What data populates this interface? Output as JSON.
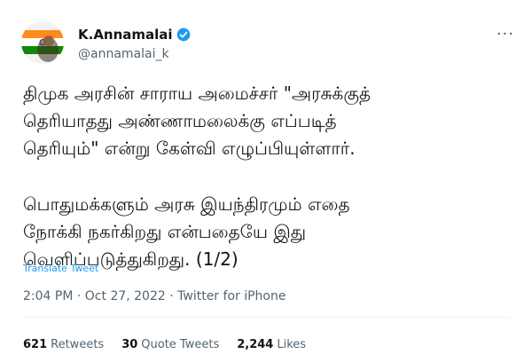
{
  "author": {
    "name": "K.Annamalai",
    "handle": "@annamalai_k",
    "verified": true
  },
  "tweet": {
    "lines": [
      "திமுக அரசின் சாராய அமைச்சர் \"அரசுக்குத்",
      "தெரியாதது அண்ணாமலைக்கு எப்படித்",
      "தெரியும்\" என்று கேள்வி எழுப்பியுள்ளார்.",
      "பொதுமக்களும் அரசு இயந்திரமும் எதை",
      "நோக்கி நகர்கிறது என்பதையே இது",
      "வெளிப்படுத்துகிறது. (1/2)"
    ]
  },
  "translate_label": "Translate Tweet",
  "meta": {
    "time": "2:04 PM",
    "date": "Oct 27, 2022",
    "sep": "·",
    "source": "Twitter for iPhone"
  },
  "stats": {
    "retweets": {
      "count": "621",
      "label": "Retweets"
    },
    "quotes": {
      "count": "30",
      "label": "Quote Tweets"
    },
    "likes": {
      "count": "2,244",
      "label": "Likes"
    }
  },
  "menu_icon": "more-icon",
  "colors": {
    "link": "#1d9bf0",
    "muted": "#536471",
    "text": "#0f1419"
  }
}
